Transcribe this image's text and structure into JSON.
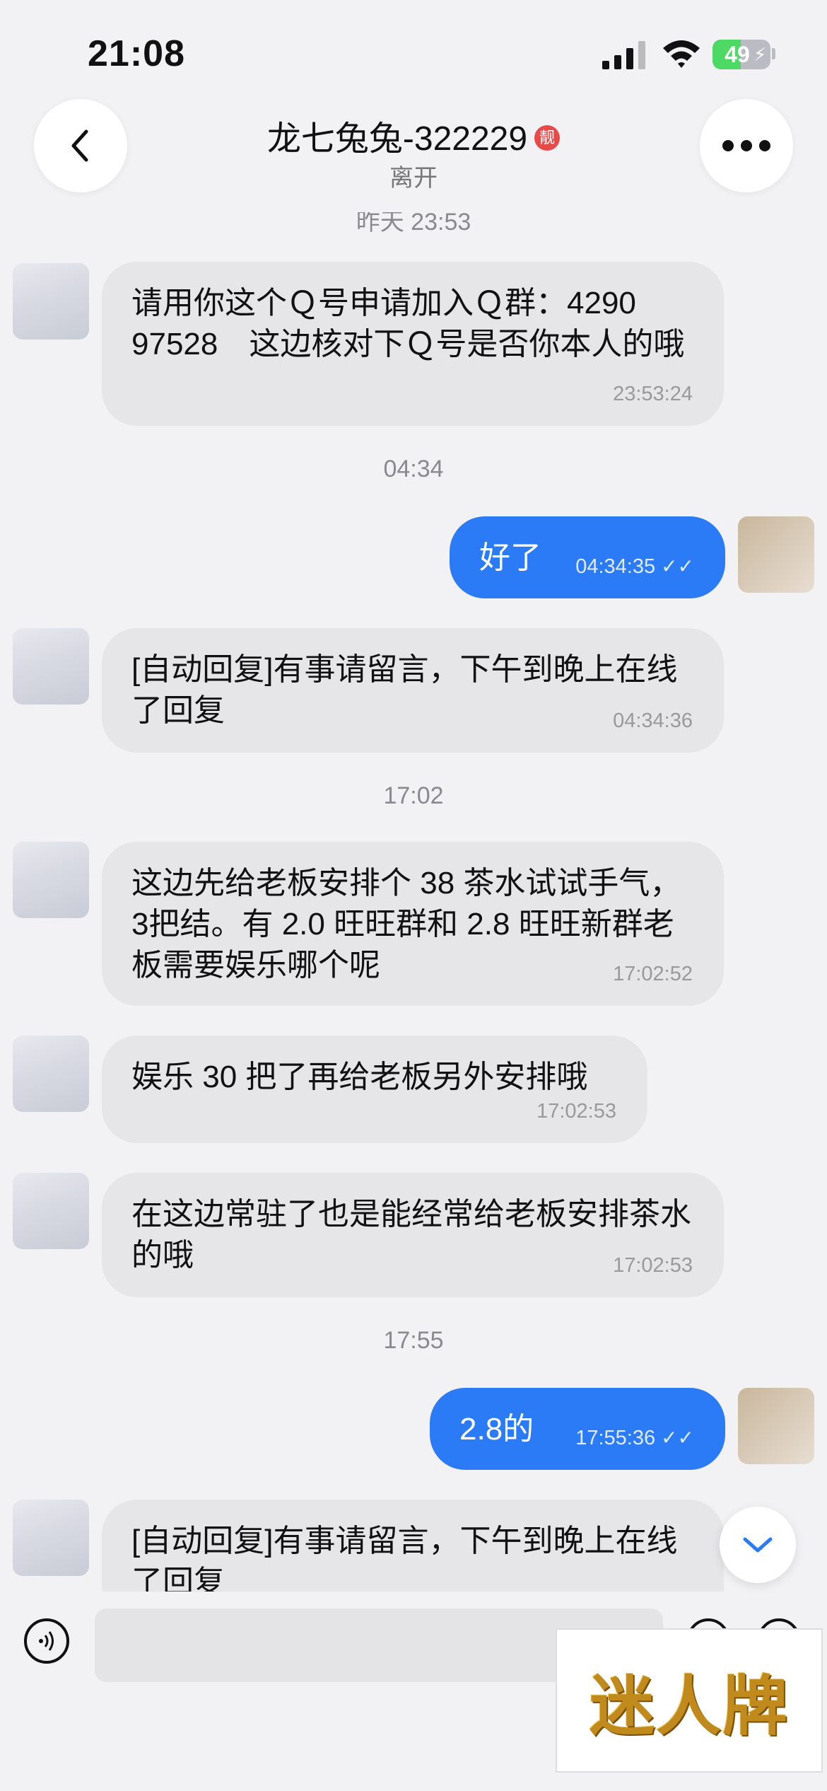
{
  "status_bar": {
    "time": "21:08",
    "battery": "49",
    "battery_level": 0.49,
    "charging": true
  },
  "header": {
    "contact_name": "龙七兔兔-322229",
    "badge": "靓",
    "status": "离开"
  },
  "chat": {
    "partial_timestamp": "昨天 23:53",
    "messages": [
      {
        "text": "请用你这个Ｑ号申请加入Ｑ群：4290 97528　这边核对下Ｑ号是否你本人的哦",
        "time": "23:53:24"
      },
      {
        "divider": "04:34"
      },
      {
        "text": "好了",
        "time": "04:34:35"
      },
      {
        "text": "[自动回复]有事请留言，下午到晚上在线了回复",
        "time": "04:34:36"
      },
      {
        "divider": "17:02"
      },
      {
        "text": "这边先给老板安排个 38 茶水试试手气，3把结。有 2.0 旺旺群和 2.8 旺旺新群老板需要娱乐哪个呢",
        "time": "17:02:52"
      },
      {
        "text": "娱乐 30 把了再给老板另外安排哦",
        "time": "17:02:53"
      },
      {
        "text": "在这边常驻了也是能经常给老板安排茶水的哦",
        "time": "17:02:53"
      },
      {
        "divider": "17:55"
      },
      {
        "text": "2.8的",
        "time": "17:55:36"
      },
      {
        "text": "[自动回复]有事请留言，下午到晚上在线了回复"
      }
    ]
  },
  "input": {
    "placeholder": ""
  },
  "watermark": "迷人牌",
  "colors": {
    "outgoing_bubble": "#2b7bf6",
    "incoming_bubble": "#e6e6e9",
    "background": "#f2f2f4"
  }
}
